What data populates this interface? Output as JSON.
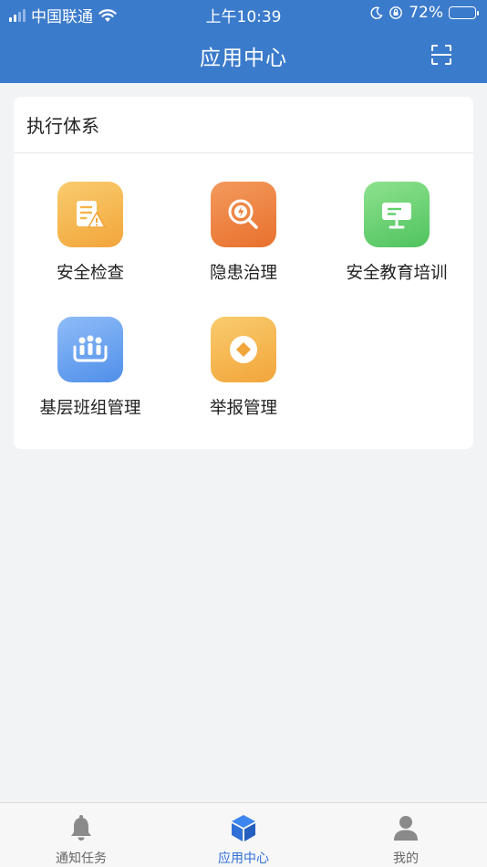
{
  "status_bar": {
    "carrier": "中国联通",
    "time": "上午10:39",
    "battery_text": "72%",
    "battery_level": 0.72
  },
  "header": {
    "title": "应用中心",
    "scan_icon": "scan-icon"
  },
  "section": {
    "title": "执行体系",
    "apps": [
      {
        "label": "安全检查",
        "icon": "checklist-warning-icon",
        "color": "#f5b44a"
      },
      {
        "label": "隐患治理",
        "icon": "magnifier-bolt-icon",
        "color": "#ee7d3b"
      },
      {
        "label": "安全教育培训",
        "icon": "signboard-icon",
        "color": "#5fcf6a"
      },
      {
        "label": "基层班组管理",
        "icon": "team-icon",
        "color": "#5a9cf2"
      },
      {
        "label": "举报管理",
        "icon": "report-diamond-icon",
        "color": "#f5b44a"
      }
    ]
  },
  "tabbar": {
    "tabs": [
      {
        "label": "通知任务",
        "icon": "bell-icon",
        "active": false
      },
      {
        "label": "应用中心",
        "icon": "cube-icon",
        "active": true
      },
      {
        "label": "我的",
        "icon": "person-icon",
        "active": false
      }
    ],
    "active_color": "#2f6fd6"
  }
}
